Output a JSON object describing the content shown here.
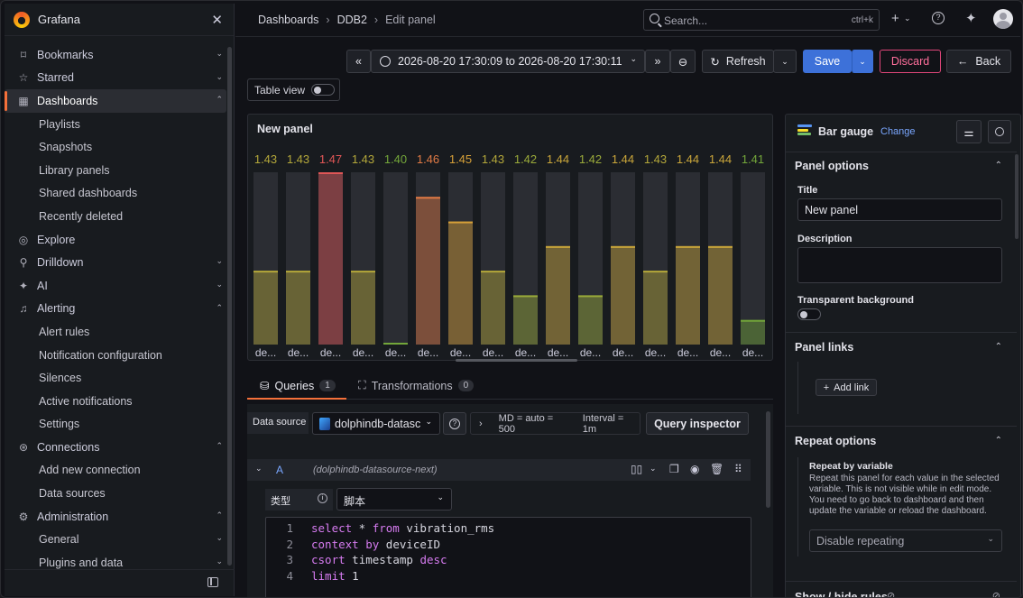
{
  "app": {
    "brand": "Grafana"
  },
  "sidebar": {
    "items": [
      {
        "label": "Bookmarks",
        "icon": "bookmark-icon",
        "level": 0,
        "chevron": "⌄"
      },
      {
        "label": "Starred",
        "icon": "star-icon",
        "level": 0,
        "chevron": "⌄"
      },
      {
        "label": "Dashboards",
        "icon": "dashboards-icon",
        "level": 0,
        "chevron": "⌃",
        "active": true
      },
      {
        "label": "Playlists",
        "level": 1
      },
      {
        "label": "Snapshots",
        "level": 1
      },
      {
        "label": "Library panels",
        "level": 1
      },
      {
        "label": "Shared dashboards",
        "level": 1
      },
      {
        "label": "Recently deleted",
        "level": 1
      },
      {
        "label": "Explore",
        "icon": "explore-icon",
        "level": 0
      },
      {
        "label": "Drilldown",
        "icon": "drilldown-icon",
        "level": 0,
        "chevron": "⌄"
      },
      {
        "label": "AI",
        "icon": "ai-sparkle-icon",
        "level": 0,
        "chevron": "⌄"
      },
      {
        "label": "Alerting",
        "icon": "bell-icon",
        "level": 0,
        "chevron": "⌃"
      },
      {
        "label": "Alert rules",
        "level": 1
      },
      {
        "label": "Notification configuration",
        "level": 1
      },
      {
        "label": "Silences",
        "level": 1
      },
      {
        "label": "Active notifications",
        "level": 1
      },
      {
        "label": "Settings",
        "level": 1
      },
      {
        "label": "Connections",
        "icon": "connections-icon",
        "level": 0,
        "chevron": "⌃"
      },
      {
        "label": "Add new connection",
        "level": 1
      },
      {
        "label": "Data sources",
        "level": 1
      },
      {
        "label": "Administration",
        "icon": "gear-icon",
        "level": 0,
        "chevron": "⌃"
      },
      {
        "label": "General",
        "level": 1,
        "chevron": "⌄"
      },
      {
        "label": "Plugins and data",
        "level": 1,
        "chevron": "⌄"
      }
    ]
  },
  "breadcrumb": {
    "items": [
      "Dashboards",
      "DDB2",
      "Edit panel"
    ]
  },
  "search": {
    "placeholder": "Search...",
    "shortcut": "ctrl+k"
  },
  "toolbar": {
    "time_range": "2026-08-20 17:30:09 to 2026-08-20 17:30:11",
    "refresh_label": "Refresh",
    "save_label": "Save",
    "discard_label": "Discard",
    "back_label": "Back"
  },
  "table_view": {
    "label": "Table view"
  },
  "panel": {
    "title": "New panel"
  },
  "chart_data": {
    "type": "bar",
    "orientation": "vertical",
    "title": "New panel",
    "categories": [
      "de...",
      "de...",
      "de...",
      "de...",
      "de...",
      "de...",
      "de...",
      "de...",
      "de...",
      "de...",
      "de...",
      "de...",
      "de...",
      "de...",
      "de...",
      "de..."
    ],
    "values": [
      1.43,
      1.43,
      1.47,
      1.43,
      1.4,
      1.46,
      1.45,
      1.43,
      1.42,
      1.44,
      1.42,
      1.44,
      1.43,
      1.44,
      1.44,
      1.41
    ],
    "value_labels": [
      "1.43",
      "1.43",
      "1.47",
      "1.43",
      "1.40",
      "1.46",
      "1.45",
      "1.43",
      "1.42",
      "1.44",
      "1.42",
      "1.44",
      "1.43",
      "1.44",
      "1.44",
      "1.41"
    ],
    "ylim": [
      1.4,
      1.47
    ],
    "colors": [
      "#b3a73a",
      "#b3a73a",
      "#e05656",
      "#b3a73a",
      "#73a63a",
      "#e07a45",
      "#d6a038",
      "#b3a73a",
      "#9aaa3a",
      "#caa63a",
      "#9aaa3a",
      "#caa63a",
      "#b3a73a",
      "#caa63a",
      "#caa63a",
      "#73a63a"
    ]
  },
  "queries": {
    "tab_queries": "Queries",
    "tab_queries_count": "1",
    "tab_transformations": "Transformations",
    "tab_transformations_count": "0",
    "datasource_label": "Data source",
    "datasource_value": "dolphindb-datasc",
    "md_info": "MD = auto = 500",
    "interval_info": "Interval = 1m",
    "inspector_label": "Query inspector",
    "query_letter": "A",
    "query_datasource": "(dolphindb-datasource-next)",
    "type_label": "类型",
    "type_value": "脚本",
    "code": [
      {
        "n": "1",
        "text": "select * from vibration_rms"
      },
      {
        "n": "2",
        "text": "context by deviceID"
      },
      {
        "n": "3",
        "text": "csort timestamp desc"
      },
      {
        "n": "4",
        "text": "limit 1"
      }
    ]
  },
  "options": {
    "viz_name": "Bar gauge",
    "change_label": "Change",
    "panel_options_title": "Panel options",
    "title_label": "Title",
    "title_value": "New panel",
    "description_label": "Description",
    "transparent_label": "Transparent background",
    "panel_links_title": "Panel links",
    "add_link_label": "Add link",
    "repeat_title": "Repeat options",
    "repeat_var_label": "Repeat by variable",
    "repeat_desc": "Repeat this panel for each value in the selected variable. This is not visible while in edit mode. You need to go back to dashboard and then update the variable or reload the dashboard.",
    "repeat_select": "Disable repeating",
    "show_hide_title": "Show / hide rules"
  }
}
